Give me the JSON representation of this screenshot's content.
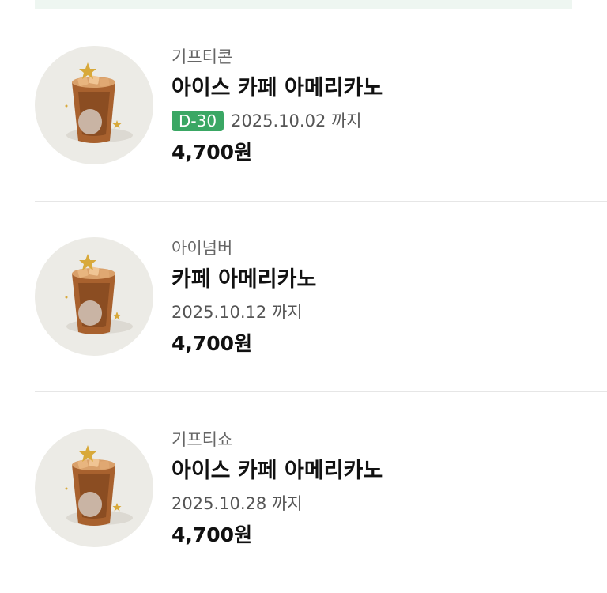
{
  "colors": {
    "badge_green": "#3aa764",
    "thumb_background": "#ecebe6",
    "divider": "#e6e6e6"
  },
  "gifts": [
    {
      "brand": "기프티콘",
      "title": "아이스 카페 아메리카노",
      "dday": "D-30",
      "expiry": "2025.10.02 까지",
      "price": "4,700원",
      "icon": "iced-americano-cup-icon"
    },
    {
      "brand": "아이넘버",
      "title": "카페 아메리카노",
      "expiry": "2025.10.12 까지",
      "price": "4,700원",
      "icon": "iced-americano-cup-icon"
    },
    {
      "brand": "기프티쇼",
      "title": "아이스 카페 아메리카노",
      "expiry": "2025.10.28 까지",
      "price": "4,700원",
      "icon": "iced-americano-cup-icon"
    }
  ]
}
